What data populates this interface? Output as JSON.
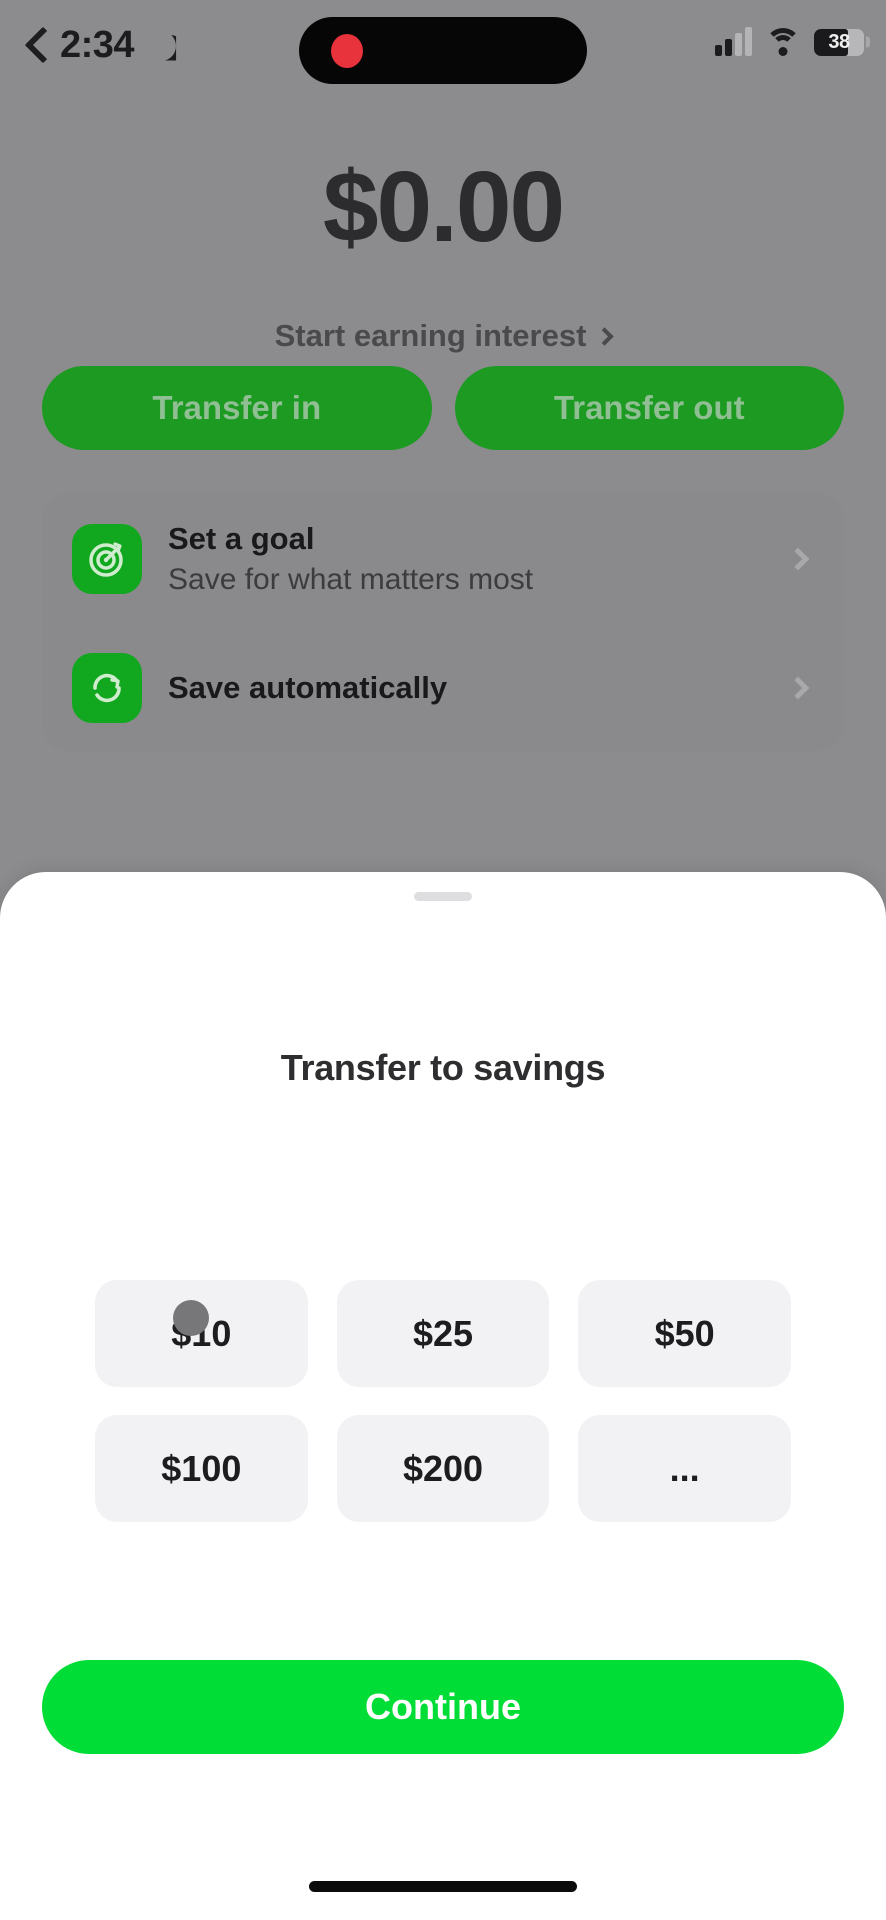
{
  "status_bar": {
    "back_icon": "chevron-left-icon",
    "time": "2:34",
    "dnd_icon": "moon-icon",
    "recording_icon": "recording-dot-icon",
    "cellular_icon": "cellular-bars-icon",
    "wifi_icon": "wifi-icon",
    "battery_level": "38"
  },
  "account": {
    "balance": "$0.00",
    "interest_link": "Start earning interest",
    "interest_chevron_icon": "chevron-right-icon"
  },
  "actions": {
    "transfer_in": "Transfer in",
    "transfer_out": "Transfer out"
  },
  "list": {
    "rows": [
      {
        "icon": "target-goal-icon",
        "title": "Set a goal",
        "subtitle": "Save for what matters most",
        "chevron_icon": "chevron-right-icon"
      },
      {
        "icon": "auto-save-icon",
        "title": "Save automatically",
        "subtitle": "",
        "chevron_icon": "chevron-right-icon"
      }
    ]
  },
  "sheet": {
    "grabber_icon": "sheet-grabber-icon",
    "title": "Transfer to savings",
    "amount_options": [
      "$10",
      "$25",
      "$50",
      "$100",
      "$200",
      "..."
    ],
    "continue_label": "Continue"
  },
  "cursor": {
    "icon": "touch-cursor-icon"
  },
  "colors": {
    "brand_green": "#00dd36",
    "dimmed_green": "#1c9a22",
    "chip_bg": "#f2f2f4",
    "scrim": "#8c8c8e"
  },
  "home_indicator_icon": "home-indicator-icon"
}
